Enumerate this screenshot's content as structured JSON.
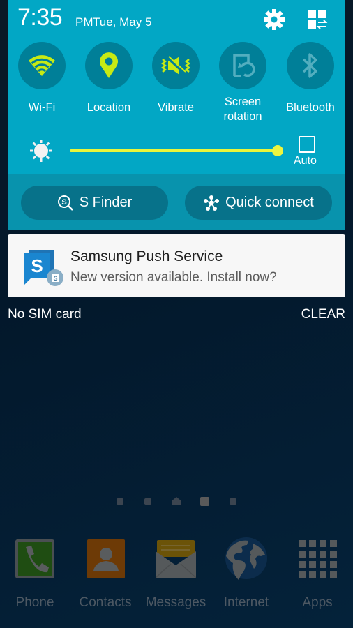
{
  "status": {
    "time": "7:35",
    "ampm": "PM",
    "date": "Tue, May 5"
  },
  "header_icons": {
    "settings": "gear-icon",
    "edit": "grid-swap-icon"
  },
  "quick_toggles": [
    {
      "label": "Wi-Fi",
      "icon": "wifi-icon",
      "active": true
    },
    {
      "label": "Location",
      "icon": "location-pin-icon",
      "active": true
    },
    {
      "label": "Vibrate",
      "icon": "vibrate-icon",
      "active": true
    },
    {
      "label": "Screen rotation",
      "label_line1": "Screen",
      "label_line2": "rotation",
      "icon": "screen-rotation-icon",
      "active": false
    },
    {
      "label": "Bluetooth",
      "icon": "bluetooth-icon",
      "active": false
    }
  ],
  "brightness": {
    "level_percent": 100,
    "auto_label": "Auto",
    "auto_checked": false
  },
  "action_buttons": {
    "s_finder": "S Finder",
    "quick_connect": "Quick connect"
  },
  "notification": {
    "app": "Samsung Push Service",
    "text": "New version available. Install now?"
  },
  "footer": {
    "carrier": "No SIM card",
    "clear": "CLEAR"
  },
  "home_pages": {
    "count": 5,
    "home_index": 2,
    "active_index": 3
  },
  "dock": [
    {
      "label": "Phone",
      "icon": "phone-icon"
    },
    {
      "label": "Contacts",
      "icon": "contacts-icon"
    },
    {
      "label": "Messages",
      "icon": "messages-icon"
    },
    {
      "label": "Internet",
      "icon": "globe-icon"
    },
    {
      "label": "Apps",
      "icon": "apps-grid-icon"
    }
  ],
  "colors": {
    "panel": "#02a7c5",
    "toggle_bg": "#007f98",
    "active_icon": "#c7ea14",
    "inactive_icon": "#52aebf",
    "slider": "#e9f53a"
  }
}
